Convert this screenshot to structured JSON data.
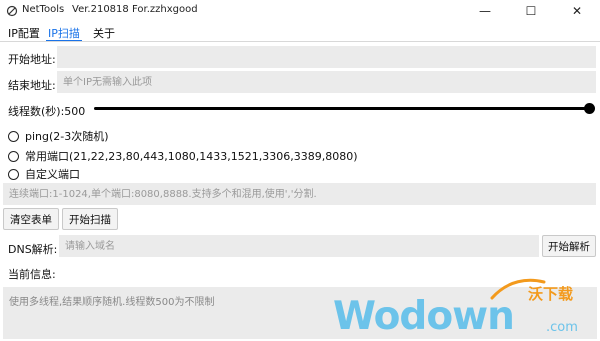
{
  "titlebar": {
    "app_name": "NetTools",
    "version": "Ver.210818",
    "for_text": "For.zzhxgood",
    "minimize": "—",
    "maximize": "☐",
    "close": "✕"
  },
  "tabs": [
    {
      "label": "IP配置",
      "active": false
    },
    {
      "label": "IP扫描",
      "active": true
    },
    {
      "label": "关于",
      "active": false
    }
  ],
  "accent_color": "#1a73e8",
  "form": {
    "start_address_label": "开始地址:",
    "start_address_value": "",
    "end_address_label": "结束地址:",
    "end_address_placeholder": "单个IP无需输入此项",
    "threads_label": "线程数(秒):500",
    "threads_value": 500
  },
  "scan_modes": [
    {
      "label": "ping(2-3次随机)",
      "selected": false
    },
    {
      "label": "常用端口(21,22,23,80,443,1080,1433,1521,3306,3389,8080)",
      "selected": false
    },
    {
      "label": "自定义端口",
      "selected": false
    }
  ],
  "port_input_placeholder": "连续端口:1-1024,单个端口:8080,8888.支持多个和混用,使用','分割.",
  "buttons": {
    "clear": "清空表单",
    "start_scan": "开始扫描",
    "start_resolve": "开始解析"
  },
  "dns": {
    "label": "DNS解析:",
    "placeholder": "请输入域名"
  },
  "current_info": {
    "label": "当前信息:",
    "text": "使用多线程,结果顺序随机.线程数500为不限制"
  },
  "watermark": {
    "cn": "沃下载",
    "brand": "Wodown",
    "domain": ".com"
  }
}
